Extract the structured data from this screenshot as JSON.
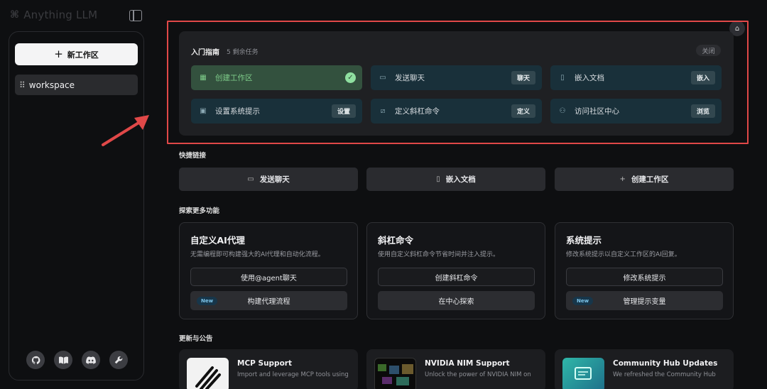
{
  "app": {
    "logo": "Anything LLM"
  },
  "sidebar": {
    "new_workspace": "新工作区",
    "workspaces": [
      {
        "name": "workspace"
      }
    ],
    "footer_icons": [
      "github-icon",
      "book-icon",
      "discord-icon",
      "wrench-icon"
    ]
  },
  "getting_started": {
    "title": "入门指南",
    "remaining": "5 剩余任务",
    "close": "关闭",
    "tasks": [
      {
        "label": "创建工作区",
        "done": true,
        "icon": "grid-icon"
      },
      {
        "label": "发送聊天",
        "button": "聊天",
        "icon": "chat-icon"
      },
      {
        "label": "嵌入文档",
        "button": "嵌入",
        "icon": "document-icon"
      },
      {
        "label": "设置系统提示",
        "button": "设置",
        "icon": "prompt-icon"
      },
      {
        "label": "定义斜杠命令",
        "button": "定义",
        "icon": "slash-icon"
      },
      {
        "label": "访问社区中心",
        "button": "浏览",
        "icon": "community-icon"
      }
    ]
  },
  "quick_links": {
    "title": "快捷链接",
    "items": [
      {
        "label": "发送聊天",
        "icon": "chat-icon"
      },
      {
        "label": "嵌入文档",
        "icon": "document-icon"
      },
      {
        "label": "创建工作区",
        "icon": "plus-icon"
      }
    ]
  },
  "explore": {
    "title": "探索更多功能",
    "cards": [
      {
        "title": "自定义AI代理",
        "desc": "无需编程即可构建强大的AI代理和自动化流程。",
        "btn1": "使用@agent聊天",
        "btn2": "构建代理流程",
        "badge": "New"
      },
      {
        "title": "斜杠命令",
        "desc": "使用自定义斜杠命令节省时间并注入提示。",
        "btn1": "创建斜杠命令",
        "btn2": "在中心探索"
      },
      {
        "title": "系统提示",
        "desc": "修改系统提示以自定义工作区的AI回复。",
        "btn1": "修改系统提示",
        "btn2": "管理提示变量",
        "badge": "New"
      }
    ]
  },
  "updates": {
    "title": "更新与公告",
    "items": [
      {
        "title": "MCP Support",
        "desc": "Import and leverage MCP tools using"
      },
      {
        "title": "NVIDIA NIM Support",
        "desc": "Unlock the power of NVIDIA NIM on"
      },
      {
        "title": "Community Hub Updates",
        "desc": "We refreshed the Community Hub"
      }
    ]
  },
  "colors": {
    "accent_green": "#8fe0a0",
    "task_bg": "#19303a",
    "annotation_red": "#e04848"
  }
}
